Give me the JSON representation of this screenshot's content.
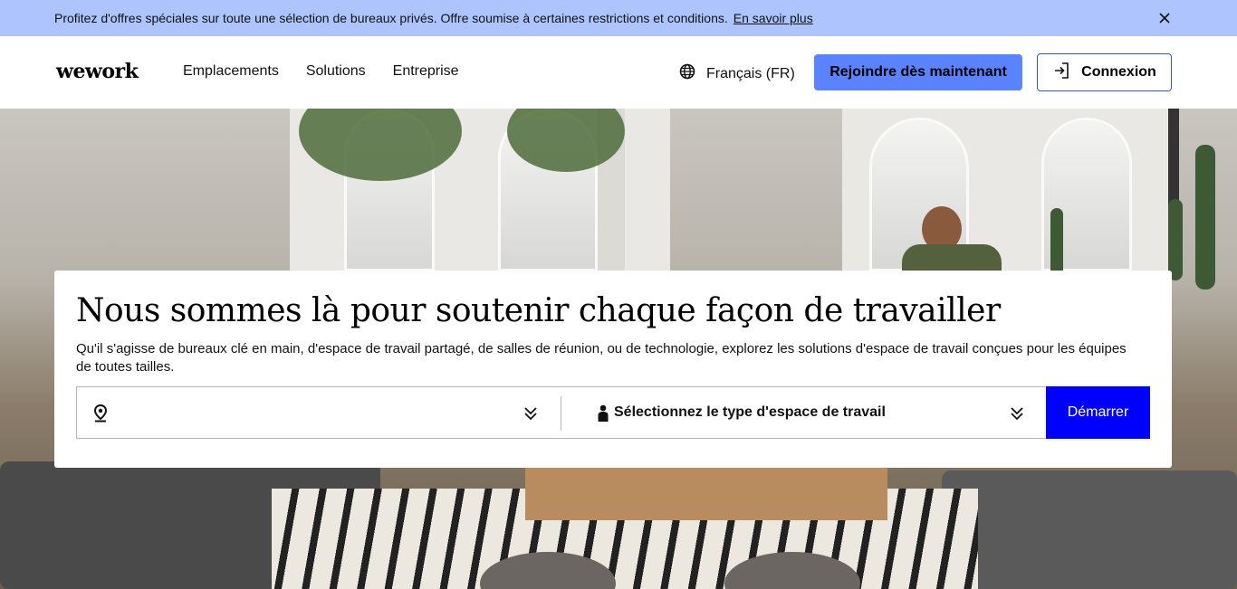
{
  "promo": {
    "text": "Profitez d'offres spéciales sur toute une sélection de bureaux privés. Offre soumise à certaines restrictions et conditions.",
    "link_label": "En savoir plus",
    "close_icon": "close-icon",
    "background": "#aec4ff"
  },
  "header": {
    "logo": "wework",
    "nav": [
      {
        "label": "Emplacements"
      },
      {
        "label": "Solutions"
      },
      {
        "label": "Entreprise"
      }
    ],
    "language": {
      "label": "Français (FR)",
      "icon": "globe-icon"
    },
    "join_label": "Rejoindre dès maintenant",
    "login_label": "Connexion",
    "login_icon": "sign-in-icon",
    "accent": "#5b83ff"
  },
  "hero": {
    "title": "Nous sommes là pour soutenir chaque façon de travailler",
    "description": "Qu'il s'agisse de bureaux clé en main, d'espace de travail partagé, de salles de réunion, ou de technologie, explorez les solutions d'espace de travail conçues pour les équipes de toutes tailles.",
    "search": {
      "location_label": "",
      "location_icon": "location-pin-icon",
      "type_label": "Sélectionnez le type d'espace de travail",
      "type_icon": "person-icon",
      "start_label": "Démarrer",
      "start_color": "#0000ff"
    }
  }
}
